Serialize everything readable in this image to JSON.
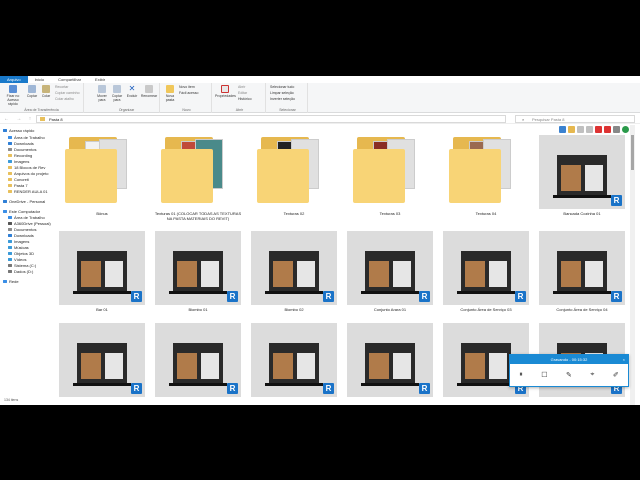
{
  "ribbon": {
    "tabs": [
      "Arquivo",
      "Início",
      "Compartilhar",
      "Exibir"
    ],
    "groups": {
      "clipboard": {
        "label": "Área de Transferência",
        "pin": "Fixar no Acesso rápido",
        "copy": "Copiar",
        "paste": "Colar",
        "cut": "Recortar",
        "copy_path": "Copiar caminho",
        "paste_shortcut": "Colar atalho"
      },
      "organize": {
        "label": "Organizar",
        "move_to": "Mover para",
        "copy_to": "Copiar para",
        "delete": "Excluir",
        "rename": "Renomear"
      },
      "new": {
        "label": "Novo",
        "new_folder": "Nova pasta",
        "new_item": "Novo item",
        "easy_access": "Fácil acesso"
      },
      "open": {
        "label": "Abrir",
        "properties": "Propriedades",
        "open": "Abrir",
        "edit": "Editar",
        "history": "Histórico"
      },
      "select": {
        "label": "Selecionar",
        "select_all": "Selecionar tudo",
        "select_none": "Limpar seleção",
        "invert": "Inverter seleção"
      }
    }
  },
  "address": {
    "path": "Pasta 8",
    "search_placeholder": "Pesquisar Pasta 8"
  },
  "sidebar": {
    "items": [
      {
        "label": "Acesso rápido",
        "color": "#2f7fd6"
      },
      {
        "label": "Área de Trabalho",
        "color": "#3a8ee6"
      },
      {
        "label": "Downloads",
        "color": "#2f7fd6"
      },
      {
        "label": "Documentos",
        "color": "#8c8c8c"
      },
      {
        "label": "Recording",
        "color": "#e8c05c"
      },
      {
        "label": "Imagens",
        "color": "#3a9ad9"
      },
      {
        "label": "18 Blocos de Rev",
        "color": "#e8c05c"
      },
      {
        "label": "Arquivos do projeto",
        "color": "#e8c05c"
      },
      {
        "label": "Concreti",
        "color": "#e8c05c"
      },
      {
        "label": "Pasta 7",
        "color": "#e8c05c"
      },
      {
        "label": "RENDER AULA 01",
        "color": "#e8c05c"
      },
      {
        "label": "OneDrive - Personal",
        "color": "#2f7fd6"
      },
      {
        "label": "Este Computador",
        "color": "#3a8ee6"
      },
      {
        "label": "Área de Trabalho",
        "color": "#3a8ee6"
      },
      {
        "label": "A360Drive (Pessoal)",
        "color": "#555555"
      },
      {
        "label": "Documentos",
        "color": "#8c8c8c"
      },
      {
        "label": "Downloads",
        "color": "#2f7fd6"
      },
      {
        "label": "Imagens",
        "color": "#3a9ad9"
      },
      {
        "label": "Músicas",
        "color": "#3a9ad9"
      },
      {
        "label": "Objetos 3D",
        "color": "#3a9ad9"
      },
      {
        "label": "Vídeos",
        "color": "#3a9ad9"
      },
      {
        "label": "Sistema (C:)",
        "color": "#777777"
      },
      {
        "label": "Dados (D:)",
        "color": "#777777"
      },
      {
        "label": "Rede",
        "color": "#3a8ee6"
      }
    ]
  },
  "files": [
    {
      "name": "Bônus",
      "kind": "folder"
    },
    {
      "name": "Texturas 01 (COLOCAR TODAS AS TEXTURAS NA PASTA MATERIAIS DO REVIT)",
      "kind": "folder"
    },
    {
      "name": "Texturas 02",
      "kind": "folder"
    },
    {
      "name": "Texturas 03",
      "kind": "folder"
    },
    {
      "name": "Texturas 04",
      "kind": "folder"
    },
    {
      "name": "Bancada Cozinha 01",
      "kind": "revit"
    },
    {
      "name": "Bar 01",
      "kind": "revit"
    },
    {
      "name": "Biombo 01",
      "kind": "revit"
    },
    {
      "name": "Biombo 02",
      "kind": "revit"
    },
    {
      "name": "Conjunto Arara 01",
      "kind": "revit"
    },
    {
      "name": "Conjunto Área de Serviço 03",
      "kind": "revit"
    },
    {
      "name": "Conjunto Área de Serviço 04",
      "kind": "revit"
    },
    {
      "name": "",
      "kind": "revit"
    },
    {
      "name": "",
      "kind": "revit"
    },
    {
      "name": "",
      "kind": "revit"
    },
    {
      "name": "",
      "kind": "revit"
    },
    {
      "name": "",
      "kind": "revit"
    },
    {
      "name": "",
      "kind": "revit"
    }
  ],
  "badge_letter": "R",
  "status": {
    "count": "134 itens"
  },
  "recorder": {
    "title": "Gravando - 00:15:32",
    "close": "×",
    "tools": [
      "⏸",
      "☐",
      "✎",
      "⌖",
      "✐"
    ]
  }
}
